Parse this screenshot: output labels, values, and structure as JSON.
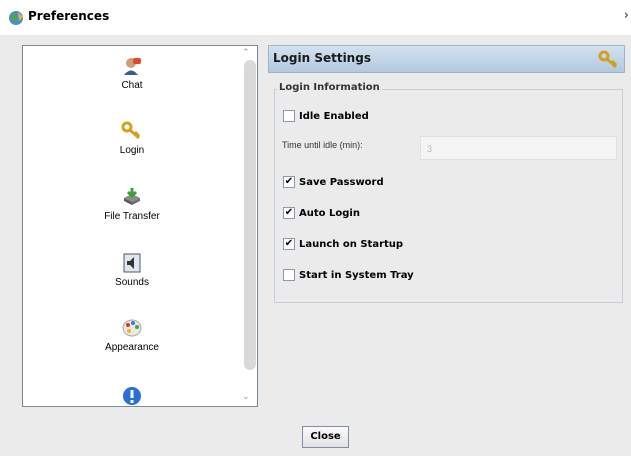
{
  "window": {
    "title": "Preferences",
    "close_glyph": "›"
  },
  "nav": {
    "items": [
      {
        "label": "Chat",
        "icon": "chat-person-icon"
      },
      {
        "label": "Login",
        "icon": "key-icon"
      },
      {
        "label": "File Transfer",
        "icon": "file-transfer-icon"
      },
      {
        "label": "Sounds",
        "icon": "speaker-icon"
      },
      {
        "label": "Appearance",
        "icon": "palette-icon"
      },
      {
        "label": "",
        "icon": "info-icon"
      }
    ]
  },
  "panel": {
    "header_title": "Login Settings",
    "header_icon": "key-icon",
    "section_legend": "Login Information",
    "idle_enabled": {
      "label": "Idle Enabled",
      "checked": false
    },
    "idle_time": {
      "label": "Time until idle (min):",
      "value": "3"
    },
    "save_password": {
      "label": "Save Password",
      "checked": true
    },
    "auto_login": {
      "label": "Auto Login",
      "checked": true
    },
    "launch_on_startup": {
      "label": "Launch on Startup",
      "checked": true
    },
    "start_in_tray": {
      "label": "Start in System Tray",
      "checked": false
    }
  },
  "close_button": {
    "label": "Close"
  }
}
